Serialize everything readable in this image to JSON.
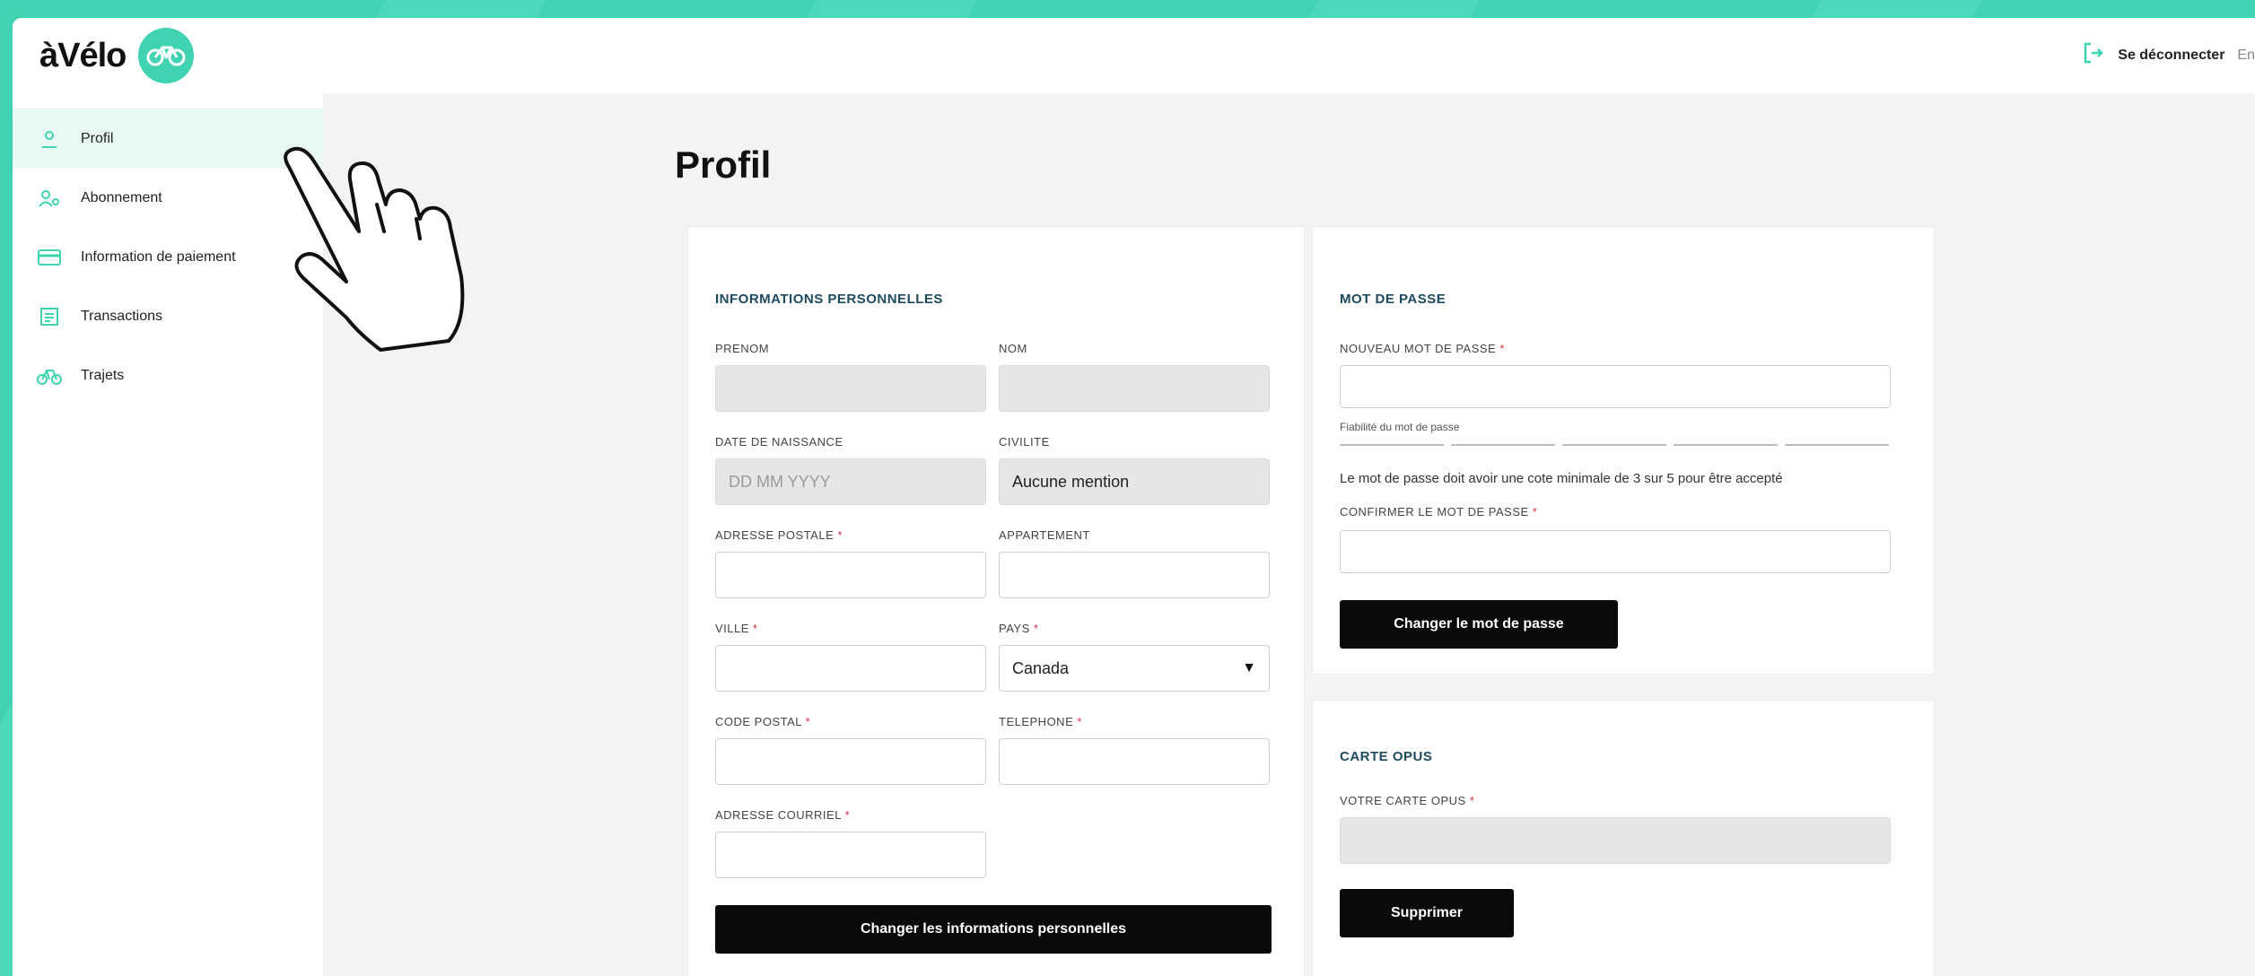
{
  "app": {
    "logo_text": "àVélo",
    "logo_icon": "bike-icon"
  },
  "header": {
    "logout_label": "Se déconnecter",
    "lang_label": "En",
    "logout_icon": "logout-icon"
  },
  "sidebar": {
    "items": [
      {
        "label": "Profil",
        "icon": "user-icon",
        "active": true
      },
      {
        "label": "Abonnement",
        "icon": "users-icon",
        "active": false
      },
      {
        "label": "Information de paiement",
        "icon": "credit-card-icon",
        "active": false
      },
      {
        "label": "Transactions",
        "icon": "receipt-icon",
        "active": false
      },
      {
        "label": "Trajets",
        "icon": "bicycle-icon",
        "active": false
      }
    ]
  },
  "page": {
    "title": "Profil"
  },
  "personal": {
    "heading": "INFORMATIONS PERSONNELLES",
    "prenom_label": "PRENOM",
    "nom_label": "NOM",
    "birth_label": "DATE DE NAISSANCE",
    "birth_placeholder": "DD MM YYYY",
    "civility_label": "CIVILITE",
    "civility_value": "Aucune mention",
    "address_label": "ADRESSE POSTALE",
    "apt_label": "APPARTEMENT",
    "city_label": "VILLE",
    "country_label": "PAYS",
    "country_value": "Canada",
    "postal_label": "CODE POSTAL",
    "phone_label": "TELEPHONE",
    "email_label": "ADRESSE COURRIEL",
    "required_mark": "*",
    "submit_label": "Changer les informations personnelles"
  },
  "password": {
    "heading": "MOT DE PASSE",
    "new_label": "NOUVEAU MOT DE PASSE",
    "strength_label": "Fiabilité du mot de passe",
    "hint": "Le mot de passe doit avoir une cote minimale de 3 sur 5 pour être accepté",
    "confirm_label": "CONFIRMER LE MOT DE PASSE",
    "submit_label": "Changer le mot de passe",
    "required_mark": "*"
  },
  "opus": {
    "heading": "CARTE OPUS",
    "card_label": "VOTRE CARTE OPUS",
    "required_mark": "*",
    "delete_label": "Supprimer"
  },
  "colors": {
    "brand": "#3fd3b1",
    "heading": "#1f4a5e",
    "required": "#e0304a",
    "button": "#0a0a0a"
  }
}
